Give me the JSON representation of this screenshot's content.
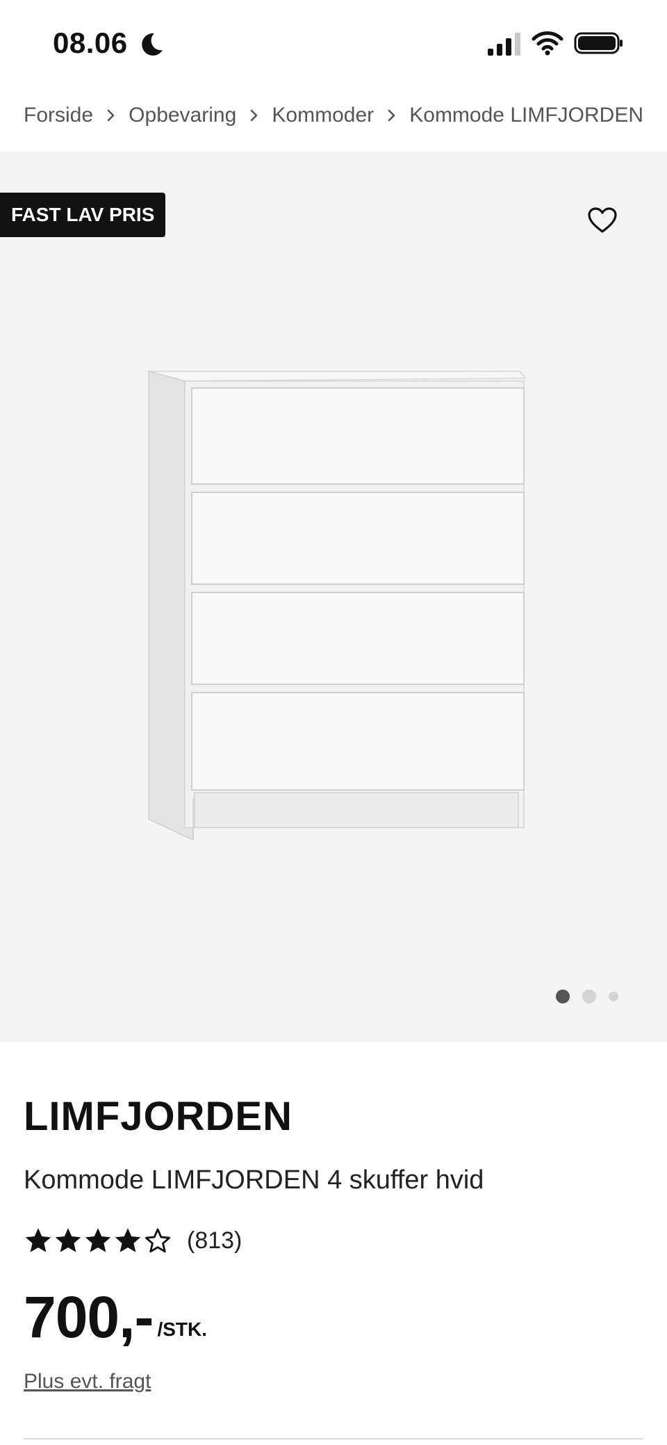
{
  "status_bar": {
    "time": "08.06"
  },
  "breadcrumb": {
    "items": [
      "Forside",
      "Opbevaring",
      "Kommoder",
      "Kommode LIMFJORDEN"
    ]
  },
  "hero": {
    "badge": "FAST LAV PRIS",
    "image_count": 3,
    "active_image_index": 0
  },
  "product": {
    "brand": "LIMFJORDEN",
    "name": "Kommode LIMFJORDEN 4 skuffer hvid",
    "rating_value": 4.5,
    "rating_max": 5,
    "review_count": "(813)",
    "price": "700,-",
    "price_unit": "/STK.",
    "shipping_link": "Plus evt. fragt"
  },
  "colors": {
    "hero_background": "#f4f4f4",
    "badge_background": "#111111",
    "badge_text": "#ffffff",
    "dot_active": "#555555",
    "dot_inactive": "#d4d4d4"
  }
}
